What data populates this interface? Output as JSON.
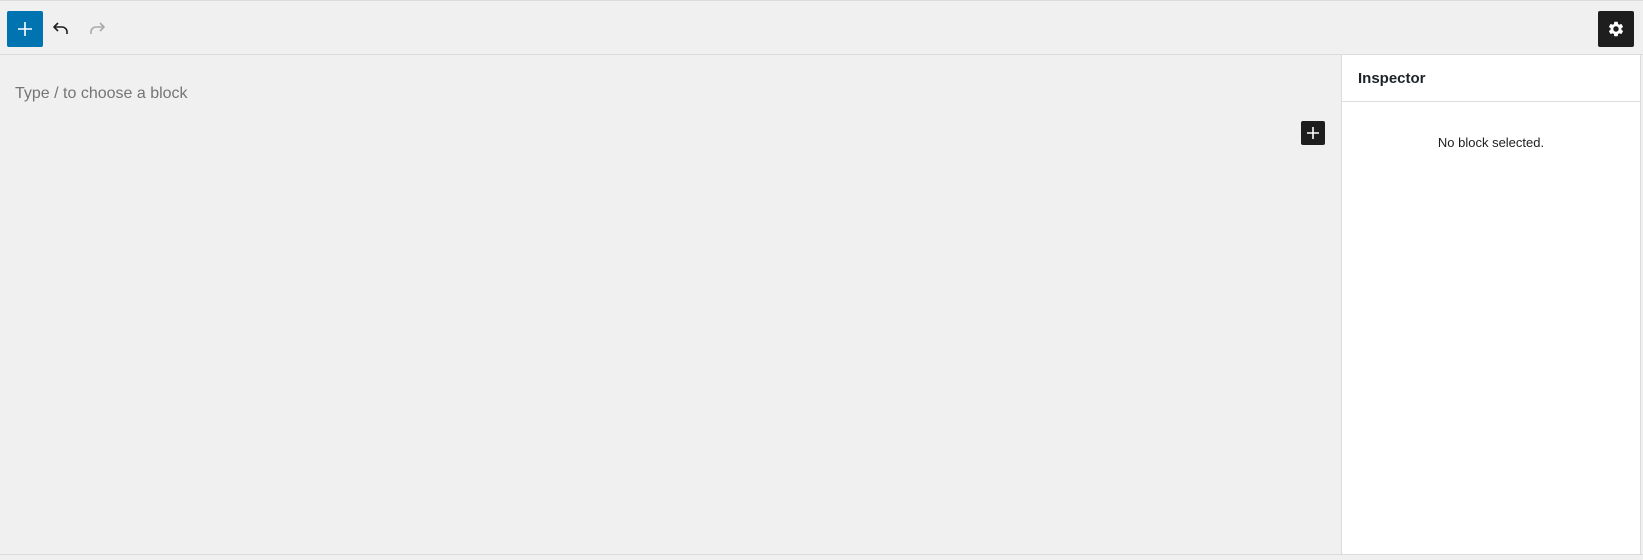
{
  "toolbar": {
    "inserter_icon": "plus-icon",
    "undo_icon": "undo-icon",
    "redo_icon": "redo-icon",
    "settings_icon": "gear-icon",
    "accent_color": "#0073b1"
  },
  "canvas": {
    "placeholder": "Type / to choose a block",
    "appender_icon": "plus-icon"
  },
  "inspector": {
    "title": "Inspector",
    "empty_message": "No block selected."
  }
}
